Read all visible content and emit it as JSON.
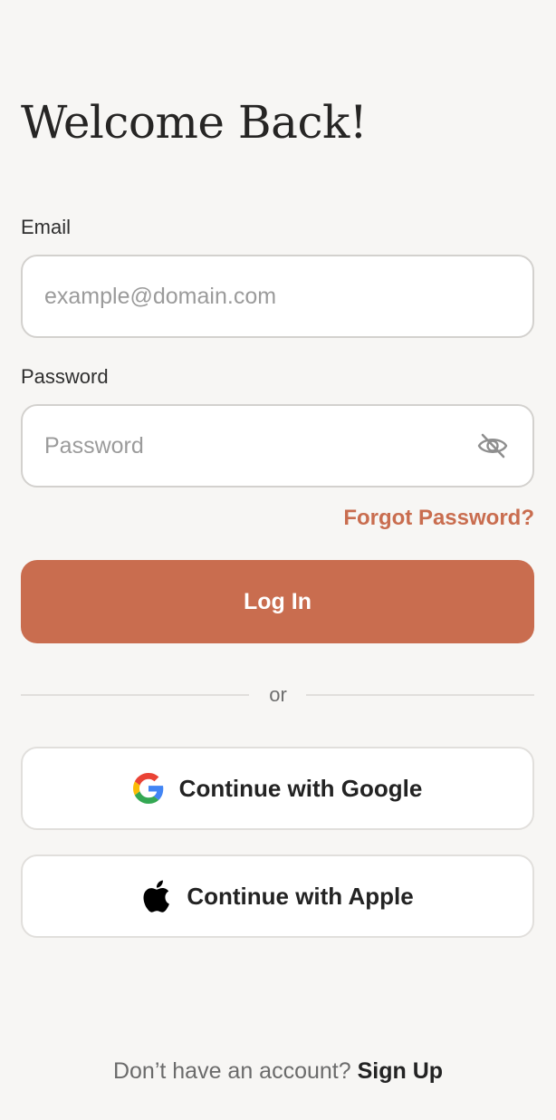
{
  "header": {
    "title": "Welcome Back!"
  },
  "form": {
    "email": {
      "label": "Email",
      "placeholder": "example@domain.com",
      "value": ""
    },
    "password": {
      "label": "Password",
      "placeholder": "Password",
      "value": "",
      "toggle_icon": "eye-off-icon"
    },
    "forgot_password": "Forgot Password?",
    "login_button": "Log In"
  },
  "divider": {
    "text": "or"
  },
  "social": {
    "google": {
      "label": "Continue with Google",
      "icon": "google-logo-icon"
    },
    "apple": {
      "label": "Continue with Apple",
      "icon": "apple-logo-icon"
    }
  },
  "footer": {
    "prompt": "Don’t have an account?",
    "signup": "Sign Up"
  },
  "colors": {
    "accent": "#c96d4f",
    "background": "#f7f6f4",
    "text": "#262626"
  }
}
